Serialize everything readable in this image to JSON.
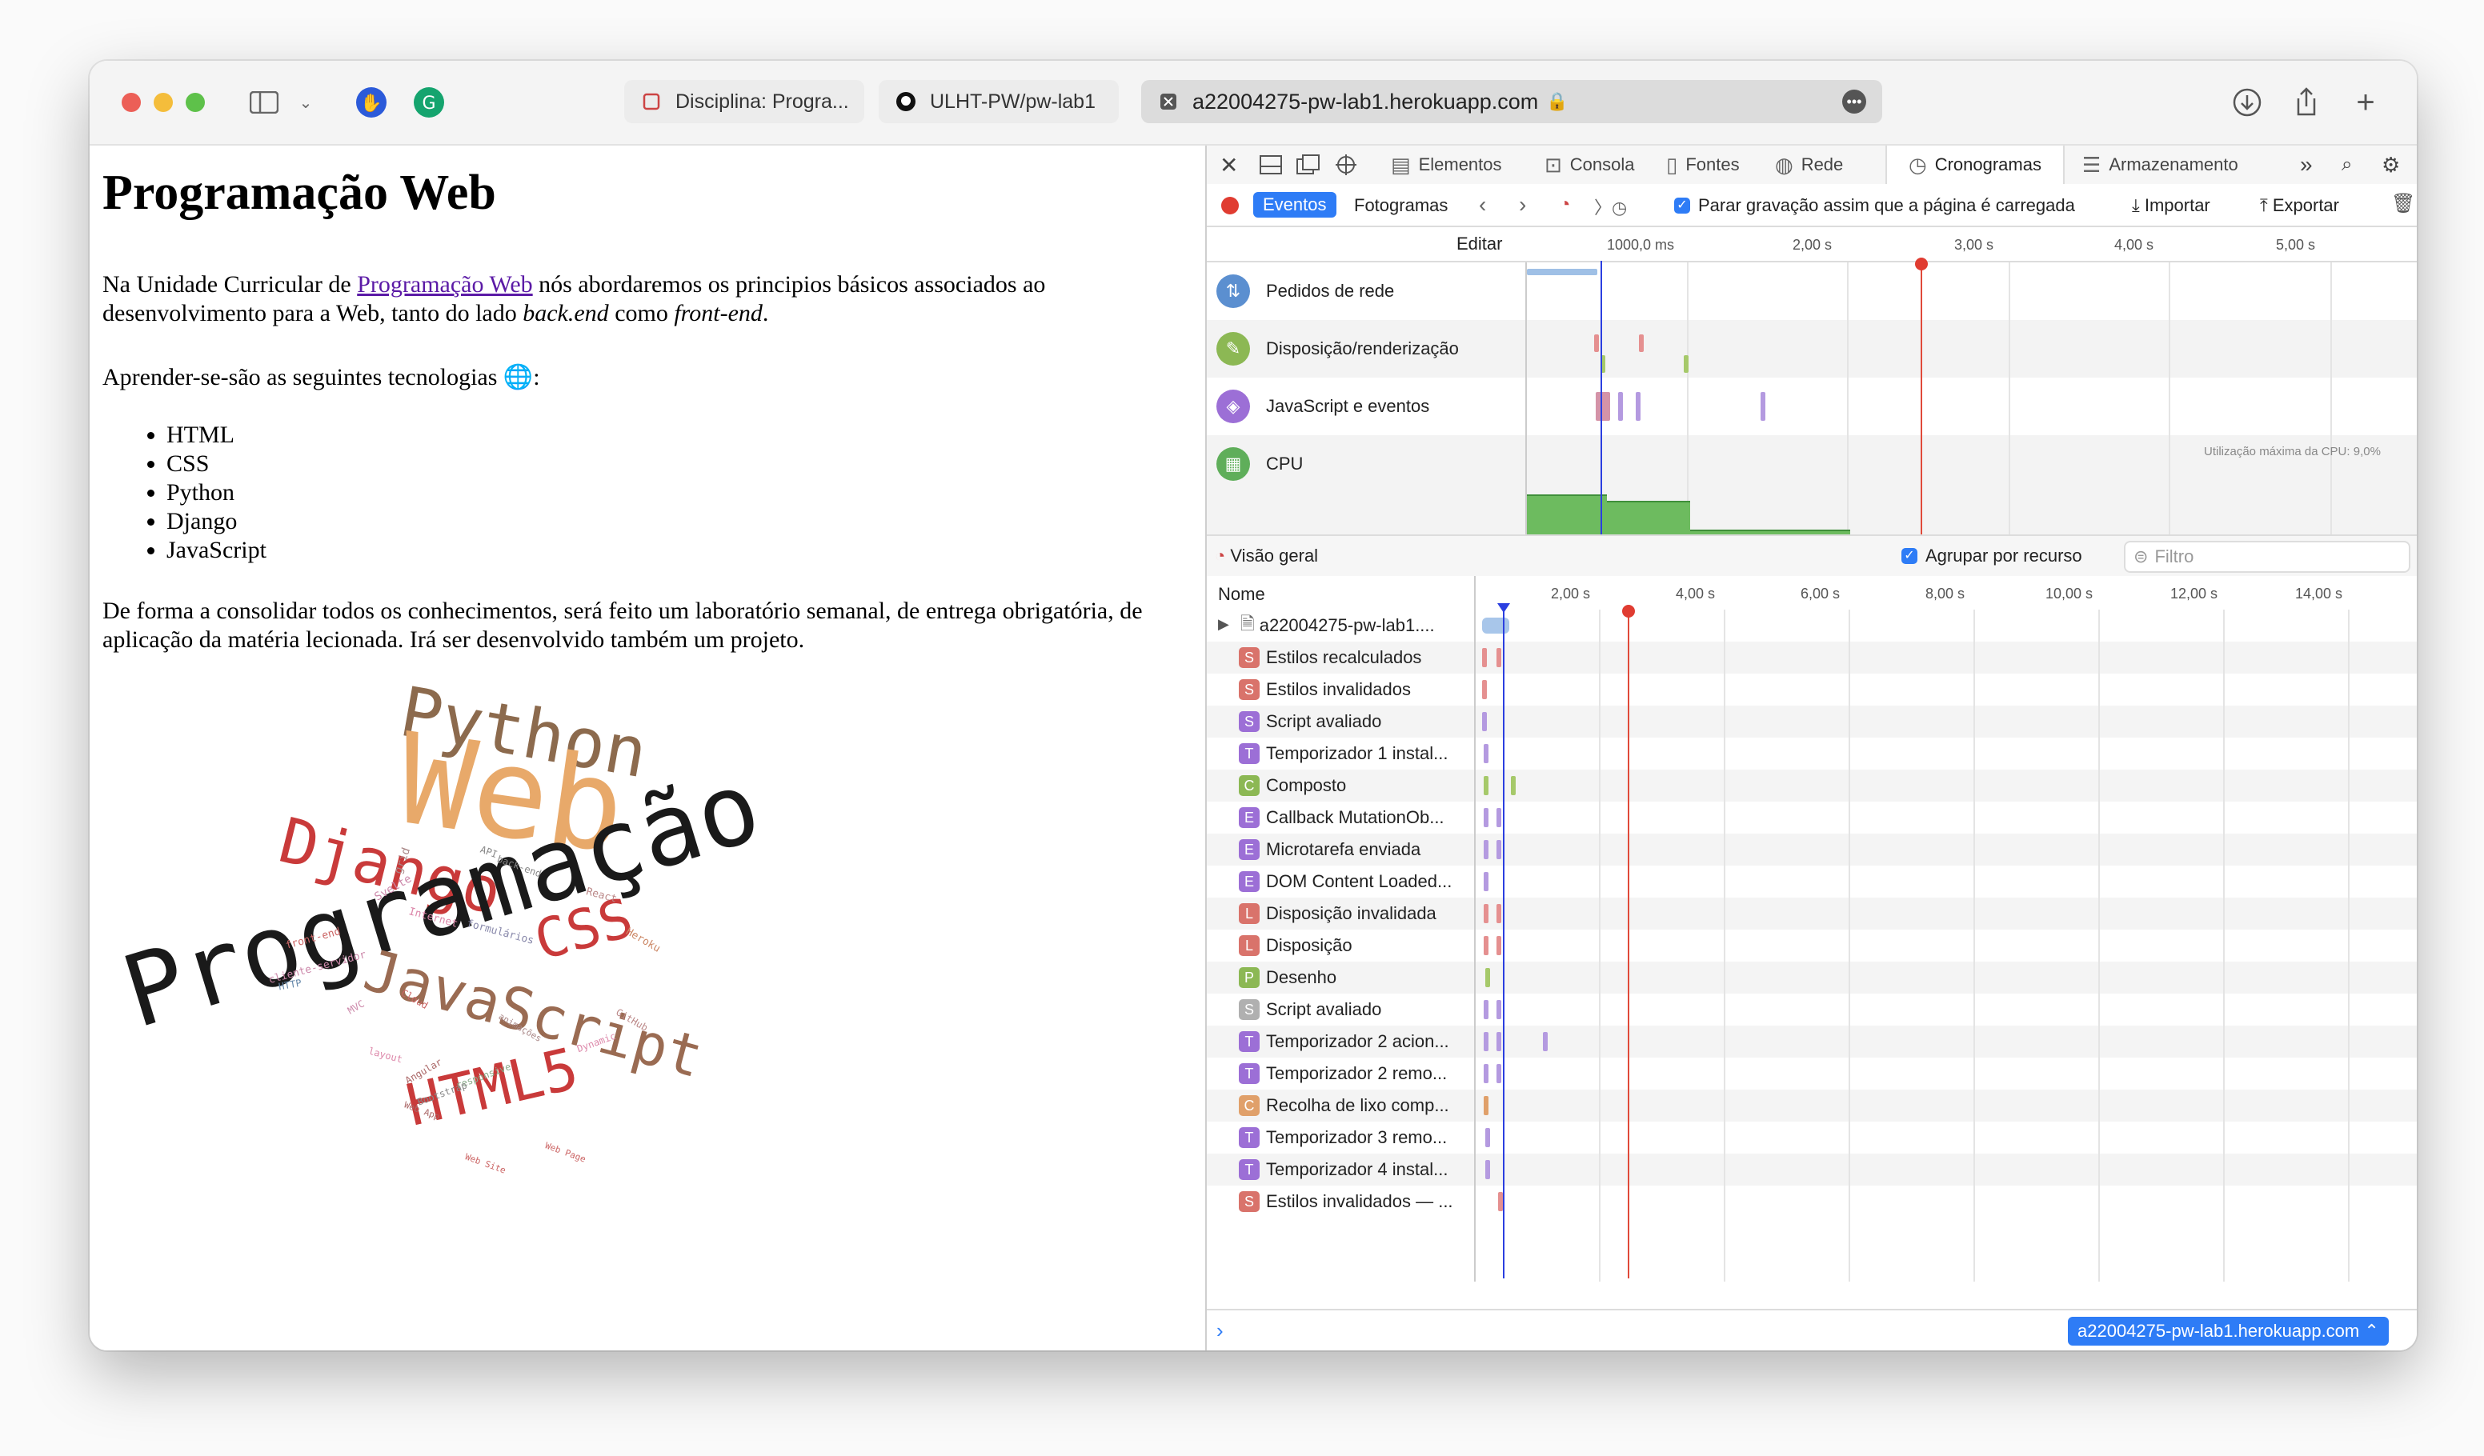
{
  "browser": {
    "tabs": [
      {
        "label": "Disciplina: Progra...",
        "icon": "square-icon"
      },
      {
        "label": "ULHT-PW/pw-lab1",
        "icon": "github-icon"
      }
    ],
    "active_tab": {
      "label": "a22004275-pw-lab1.herokuapp.com",
      "icon": "lock-icon"
    }
  },
  "page": {
    "title": "Programação Web",
    "intro_before_link": "Na Unidade Curricular de ",
    "intro_link": "Programação Web",
    "intro_after_link": " nós abordaremos os principios básicos associados ao desenvolvimento para a Web, tanto do lado ",
    "intro_em1": "back.end",
    "intro_mid": " como ",
    "intro_em2": "front-end",
    "intro_end": ".",
    "techs_intro": "Aprender-se-são as seguintes tecnologias",
    "techs_emoji": "🌐",
    "techs_colon": ":",
    "techs": [
      "HTML",
      "CSS",
      "Python",
      "Django",
      "JavaScript"
    ],
    "conclusion": "De forma a consolidar todos os conhecimentos, será feito um laboratório semanal, de entrega obrigatória, de aplicação da matéria lecionada. Irá ser desenvolvido também um projeto.",
    "word_cloud": {
      "big": [
        "Programação",
        "Web",
        "Python",
        "Django",
        "JavaScript",
        "CSS",
        "HTML5"
      ],
      "small": [
        "grid",
        "Svelte",
        "API",
        "back-end",
        "Internet",
        "formulários",
        "React",
        "front-end",
        "cliente-servidor",
        "Heroku",
        "HTTP",
        "MVC",
        "Cloud",
        "GitHub",
        "animações",
        "Dynamic",
        "layout",
        "Angular",
        "responsive",
        "Bootstrap",
        "Web App",
        "Web Page",
        "Web Site"
      ]
    }
  },
  "devtools": {
    "tabs": [
      "Elementos",
      "Consola",
      "Fontes",
      "Rede",
      "Cronogramas",
      "Armazenamento"
    ],
    "active_tab": "Cronogramas",
    "toolbar": {
      "eventos": "Eventos",
      "fotogramas": "Fotogramas",
      "stop_on_load": "Parar gravação assim que a página é carregada",
      "import": "Importar",
      "export": "Exportar"
    },
    "ruler": {
      "edit": "Editar",
      "ticks": [
        "1000,0 ms",
        "2,00 s",
        "3,00 s",
        "4,00 s",
        "5,00 s"
      ]
    },
    "timelines": [
      {
        "label": "Pedidos de rede",
        "color": "#5b8fd0",
        "icon": "network-icon"
      },
      {
        "label": "Disposição/renderização",
        "color": "#8cb854",
        "icon": "brush-icon"
      },
      {
        "label": "JavaScript e eventos",
        "color": "#9c6fd6",
        "icon": "script-icon"
      },
      {
        "label": "CPU",
        "color": "#5fae5a",
        "icon": "cpu-icon"
      }
    ],
    "cpu_max": "Utilização máxima da CPU: 9,0%",
    "overview": {
      "label": "Visão geral",
      "group_by_resource": "Agrupar por recurso",
      "filter_placeholder": "Filtro"
    },
    "records": {
      "name_header": "Nome",
      "ticks": [
        "2,00 s",
        "4,00 s",
        "6,00 s",
        "8,00 s",
        "10,00 s",
        "12,00 s",
        "14,00 s"
      ],
      "rows": [
        {
          "badge": "S",
          "label": "Estilos recalculados",
          "color": "#d9736b"
        },
        {
          "badge": "S",
          "label": "Estilos invalidados",
          "color": "#d9736b"
        },
        {
          "badge": "S",
          "label": "Script avaliado",
          "color": "#9c6fd6"
        },
        {
          "badge": "T",
          "label": "Temporizador 1 instal...",
          "color": "#9c6fd6"
        },
        {
          "badge": "C",
          "label": "Composto",
          "color": "#8cb854"
        },
        {
          "badge": "E",
          "label": "Callback MutationOb...",
          "color": "#9c6fd6"
        },
        {
          "badge": "E",
          "label": "Microtarefa enviada",
          "color": "#9c6fd6"
        },
        {
          "badge": "E",
          "label": "DOM Content Loaded...",
          "color": "#9c6fd6"
        },
        {
          "badge": "L",
          "label": "Disposição invalidada",
          "color": "#d9736b"
        },
        {
          "badge": "L",
          "label": "Disposição",
          "color": "#d9736b"
        },
        {
          "badge": "P",
          "label": "Desenho",
          "color": "#8cb854"
        },
        {
          "badge": "S",
          "label": "Script avaliado",
          "color": "#b0b0b0"
        },
        {
          "badge": "T",
          "label": "Temporizador 2 acion...",
          "color": "#9c6fd6"
        },
        {
          "badge": "T",
          "label": "Temporizador 2 remo...",
          "color": "#9c6fd6"
        },
        {
          "badge": "C",
          "label": "Recolha de lixo comp...",
          "color": "#e0a06a"
        },
        {
          "badge": "T",
          "label": "Temporizador 3 remo...",
          "color": "#9c6fd6"
        },
        {
          "badge": "T",
          "label": "Temporizador 4 instal...",
          "color": "#9c6fd6"
        },
        {
          "badge": "S",
          "label": "Estilos invalidados — ...",
          "color": "#d9736b"
        }
      ],
      "root_label": "a22004275-pw-lab1...."
    },
    "footer_target": "a22004275-pw-lab1.herokuapp.com"
  }
}
